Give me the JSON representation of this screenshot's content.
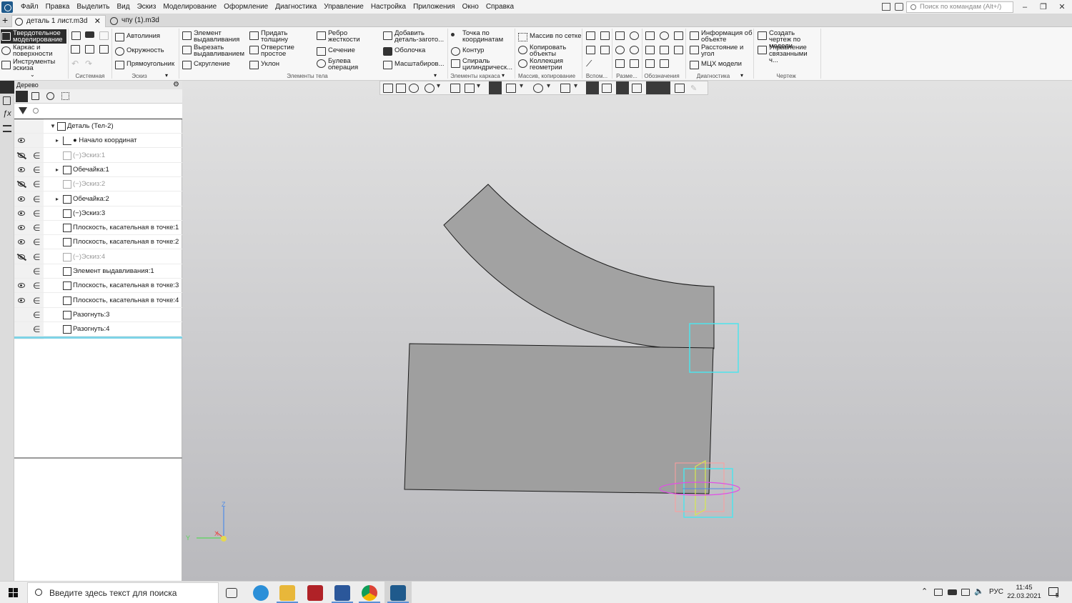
{
  "menubar": {
    "items": [
      "Файл",
      "Правка",
      "Выделить",
      "Вид",
      "Эскиз",
      "Моделирование",
      "Оформление",
      "Диагностика",
      "Управление",
      "Настройка",
      "Приложения",
      "Окно",
      "Справка"
    ],
    "search_placeholder": "Поиск по командам (Alt+/)"
  },
  "tabs": [
    {
      "label": "деталь 1 лист.m3d",
      "active": true
    },
    {
      "label": "чпу (1).m3d",
      "active": false
    }
  ],
  "ribbon": {
    "modes": [
      "Твердотельное моделирование",
      "Каркас и поверхности",
      "Инструменты эскиза"
    ],
    "sketch": [
      "Автолиния",
      "Окружность",
      "Прямоугольник"
    ],
    "body1": [
      "Элемент выдавливания",
      "Вырезать выдавливанием",
      "Скругление"
    ],
    "body2": [
      "Придать толщину",
      "Отверстие простое",
      "Уклон"
    ],
    "body3": [
      "Ребро жесткости",
      "Сечение",
      "Булева операция"
    ],
    "body4": [
      "Добавить деталь-загото...",
      "Оболочка",
      "Масштабиров..."
    ],
    "frame": [
      "Точка по координатам",
      "Контур",
      "Спираль цилиндрическ..."
    ],
    "array": [
      "Массив по сетке",
      "Копировать объекты",
      "Коллекция геометрии"
    ],
    "diag": [
      "Информация об объекте",
      "Расстояние и угол",
      "МЦХ модели"
    ],
    "drawing": [
      "Создать чертеж по модели",
      "Управление связанными ч..."
    ],
    "groups": [
      "Системная",
      "Эскиз",
      "Элементы тела",
      "Элементы каркаса",
      "Массив, копирование",
      "Вспом...",
      "Разме...",
      "Обозначения",
      "Диагностика",
      "Чертеж"
    ]
  },
  "tree": {
    "title": "Дерево",
    "rows": [
      {
        "label": "Деталь (Тел-2)",
        "eye": "none",
        "elem": false,
        "dim": false,
        "expander": "down"
      },
      {
        "label": "● Начало координат",
        "eye": "on",
        "elem": false,
        "dim": false,
        "expander": "right"
      },
      {
        "label": "(−)Эскиз:1",
        "eye": "off",
        "elem": true,
        "dim": true,
        "expander": "none"
      },
      {
        "label": "Обечайка:1",
        "eye": "on",
        "elem": true,
        "dim": false,
        "expander": "right"
      },
      {
        "label": "(−)Эскиз:2",
        "eye": "off",
        "elem": true,
        "dim": true,
        "expander": "none"
      },
      {
        "label": "Обечайка:2",
        "eye": "on",
        "elem": true,
        "dim": false,
        "expander": "right"
      },
      {
        "label": "(−)Эскиз:3",
        "eye": "on",
        "elem": true,
        "dim": false,
        "expander": "none"
      },
      {
        "label": "Плоскость, касательная в точке:1",
        "eye": "on",
        "elem": true,
        "dim": false,
        "expander": "none"
      },
      {
        "label": "Плоскость, касательная в точке:2",
        "eye": "on",
        "elem": true,
        "dim": false,
        "expander": "none"
      },
      {
        "label": "(−)Эскиз:4",
        "eye": "off",
        "elem": true,
        "dim": true,
        "expander": "none"
      },
      {
        "label": "Элемент выдавливания:1",
        "eye": "none",
        "elem": true,
        "dim": false,
        "expander": "none"
      },
      {
        "label": "Плоскость, касательная в точке:3",
        "eye": "on",
        "elem": true,
        "dim": false,
        "expander": "none"
      },
      {
        "label": "Плоскость, касательная в точке:4",
        "eye": "on",
        "elem": true,
        "dim": false,
        "expander": "none"
      },
      {
        "label": "Разогнуть:3",
        "eye": "none",
        "elem": true,
        "dim": false,
        "expander": "none"
      },
      {
        "label": "Разогнуть:4",
        "eye": "none",
        "elem": true,
        "dim": false,
        "expander": "none"
      }
    ]
  },
  "axes": {
    "z": "Z",
    "y": "Y",
    "x": "X"
  },
  "taskbar": {
    "search_placeholder": "Введите здесь текст для поиска",
    "lang": "РУС",
    "time": "11:45",
    "date": "22.03.2021",
    "notif_count": "5"
  },
  "colors": {
    "accent_cyan": "#4fe3ec",
    "part_fill": "#a2a2a2",
    "active_tab_line": "#7ed3e6"
  }
}
